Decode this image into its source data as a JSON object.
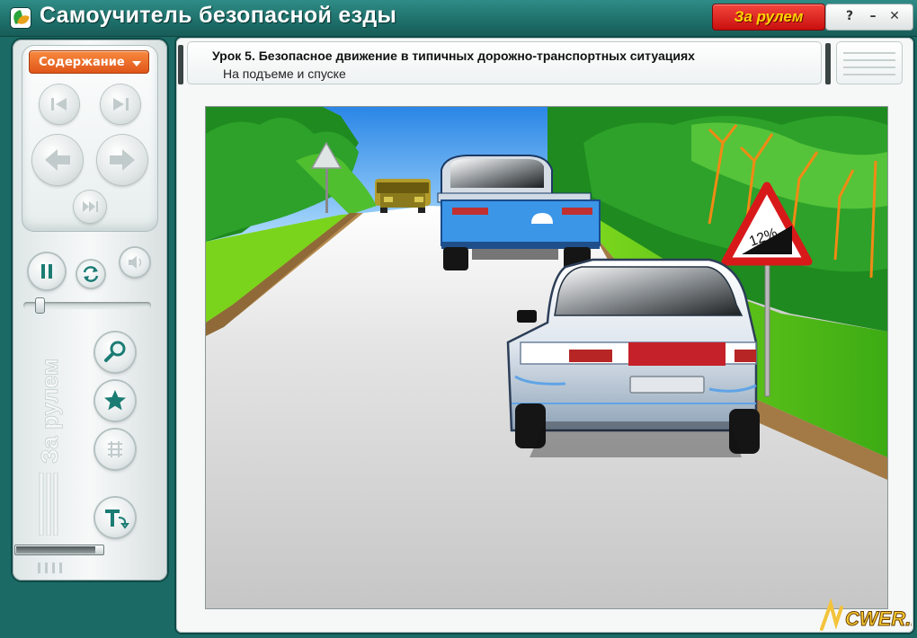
{
  "window": {
    "title": "Самоучитель безопасной езды",
    "brand_button": "За рулем",
    "help_label": "?",
    "minimize_label": "–",
    "close_label": "✕"
  },
  "sidebar": {
    "contents_dropdown": "Содержание",
    "watermark": "За рулем",
    "nav_icons": [
      "first-page-icon",
      "last-page-icon",
      "previous-icon",
      "next-icon",
      "skip-icon"
    ],
    "tool_icons": [
      "pause-icon",
      "refresh-icon",
      "sound-icon",
      "magnifier-icon",
      "star-icon",
      "grid-icon",
      "text-icon"
    ],
    "volume_level": 0.1,
    "progress_level": 0.92
  },
  "lesson": {
    "title": "Урок 5. Безопасное движение в типичных дорожно-транспортных ситуациях",
    "subtitle": "На подъеме и спуске"
  },
  "scene": {
    "sign_label": "12%"
  },
  "colors": {
    "frame_teal": "#1b6a65",
    "brand_red": "#d8191a",
    "brand_yellow": "#ffd400",
    "dropdown_orange": "#ee6a25"
  },
  "site_logo": "CWER.RU"
}
